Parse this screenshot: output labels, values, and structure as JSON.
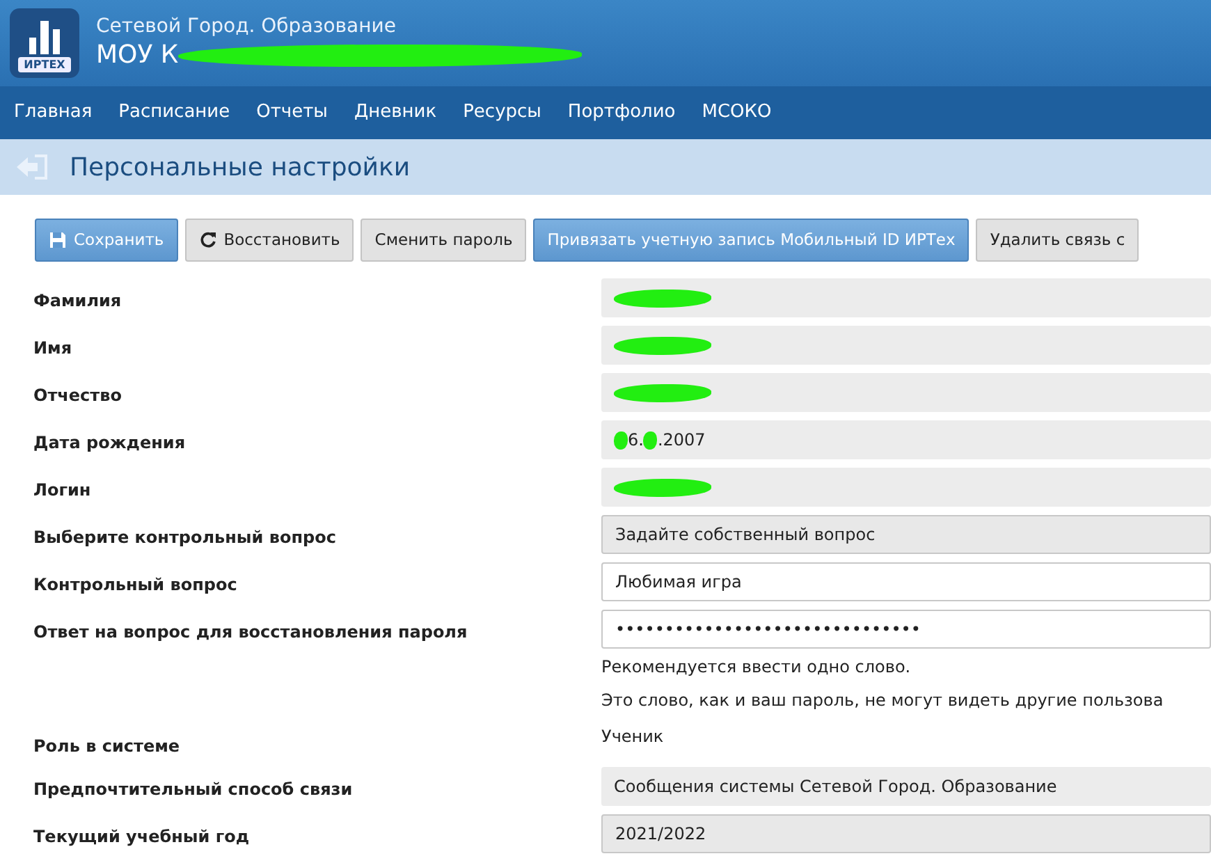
{
  "header": {
    "logo_text": "ИРТЕХ",
    "system_name": "Сетевой Город. Образование",
    "school": {
      "segments": [
        {
          "kind": "text",
          "text": "МОУ К"
        },
        {
          "kind": "redaction"
        }
      ]
    }
  },
  "nav": [
    {
      "label": "Главная"
    },
    {
      "label": "Расписание"
    },
    {
      "label": "Отчеты"
    },
    {
      "label": "Дневник"
    },
    {
      "label": "Ресурсы"
    },
    {
      "label": "Портфолио"
    },
    {
      "label": "МСОКО"
    }
  ],
  "page_title": "Персональные настройки",
  "toolbar": [
    {
      "label": "Сохранить",
      "kind": "primary"
    },
    {
      "label": "Восстановить",
      "kind": "secondary"
    },
    {
      "label": "Сменить пароль",
      "kind": "secondary"
    },
    {
      "label": "Привязать учетную запись Мобильный ID ИРТех",
      "kind": "primary"
    },
    {
      "label": "Удалить связь с",
      "kind": "secondary"
    }
  ],
  "fields": [
    {
      "label": "Фамилия",
      "kind": "readonly",
      "segments": [
        {
          "kind": "redaction"
        }
      ]
    },
    {
      "label": "Имя",
      "kind": "readonly",
      "segments": [
        {
          "kind": "redaction"
        }
      ]
    },
    {
      "label": "Отчество",
      "kind": "readonly",
      "segments": [
        {
          "kind": "redaction"
        }
      ]
    },
    {
      "label": "Дата рождения",
      "kind": "readonly",
      "segments": [
        {
          "kind": "redaction"
        },
        {
          "kind": "text",
          "text": "6."
        },
        {
          "kind": "redaction"
        },
        {
          "kind": "text",
          "text": ".2007"
        }
      ]
    },
    {
      "label": "Логин",
      "kind": "readonly",
      "segments": [
        {
          "kind": "redaction"
        }
      ]
    },
    {
      "label": "Выберите контрольный вопрос",
      "kind": "select",
      "value": "Задайте собственный вопрос"
    },
    {
      "label": "Контрольный вопрос",
      "kind": "input",
      "value": "Любимая игра"
    },
    {
      "label": "Ответ на вопрос для восстановления пароля",
      "kind": "input",
      "value": "•••••••••••••••••••••••••••••••",
      "hints": [
        "Рекомендуется ввести одно слово.",
        "Это слово, как и ваш пароль, не могут видеть другие пользова"
      ]
    },
    {
      "label": "Роль в системе",
      "kind": "text",
      "value": "Ученик"
    },
    {
      "label": "Предпочтительный способ связи",
      "kind": "readonly",
      "value": "Сообщения системы Сетевой Город. Образование"
    },
    {
      "label": "Текущий учебный год",
      "kind": "select",
      "value": "2021/2022"
    }
  ]
}
